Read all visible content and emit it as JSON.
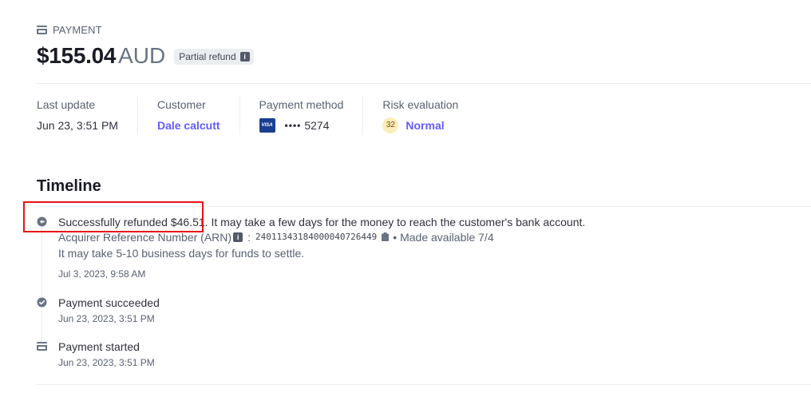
{
  "header": {
    "kicker_icon": "card-icon",
    "kicker": "PAYMENT",
    "amount": "$155.04",
    "currency": "AUD",
    "badge": "Partial refund",
    "badge_icon": "info-icon"
  },
  "summary": {
    "last_update_label": "Last update",
    "last_update_value": "Jun 23, 3:51 PM",
    "customer_label": "Customer",
    "customer_value": "Dale calcutt",
    "payment_method_label": "Payment method",
    "card_brand": "VISA",
    "card_dots": "••••",
    "card_last4": "5274",
    "risk_label": "Risk evaluation",
    "risk_score": "32",
    "risk_value": "Normal"
  },
  "timeline": {
    "title": "Timeline",
    "events": [
      {
        "icon": "refund-icon",
        "title_highlight": "Successfully refunded $46.51.",
        "title_rest": " It may take a few days for the money to reach the customer's bank account.",
        "arn_label": "Acquirer Reference Number (ARN)",
        "arn_colon": ":",
        "arn_value": "24011343184000040726449",
        "made_available": "• Made available 7/4",
        "settle_note": "It may take 5-10 business days for funds to settle.",
        "time": "Jul 3, 2023, 9:58 AM"
      },
      {
        "icon": "check-circle-icon",
        "title": "Payment succeeded",
        "time": "Jun 23, 2023, 3:51 PM"
      },
      {
        "icon": "card-icon",
        "title": "Payment started",
        "time": "Jun 23, 2023, 3:51 PM"
      }
    ]
  },
  "colors": {
    "accent": "#635bff",
    "highlight_box": "#e8131a",
    "risk_badge_bg": "#fcedb9"
  }
}
